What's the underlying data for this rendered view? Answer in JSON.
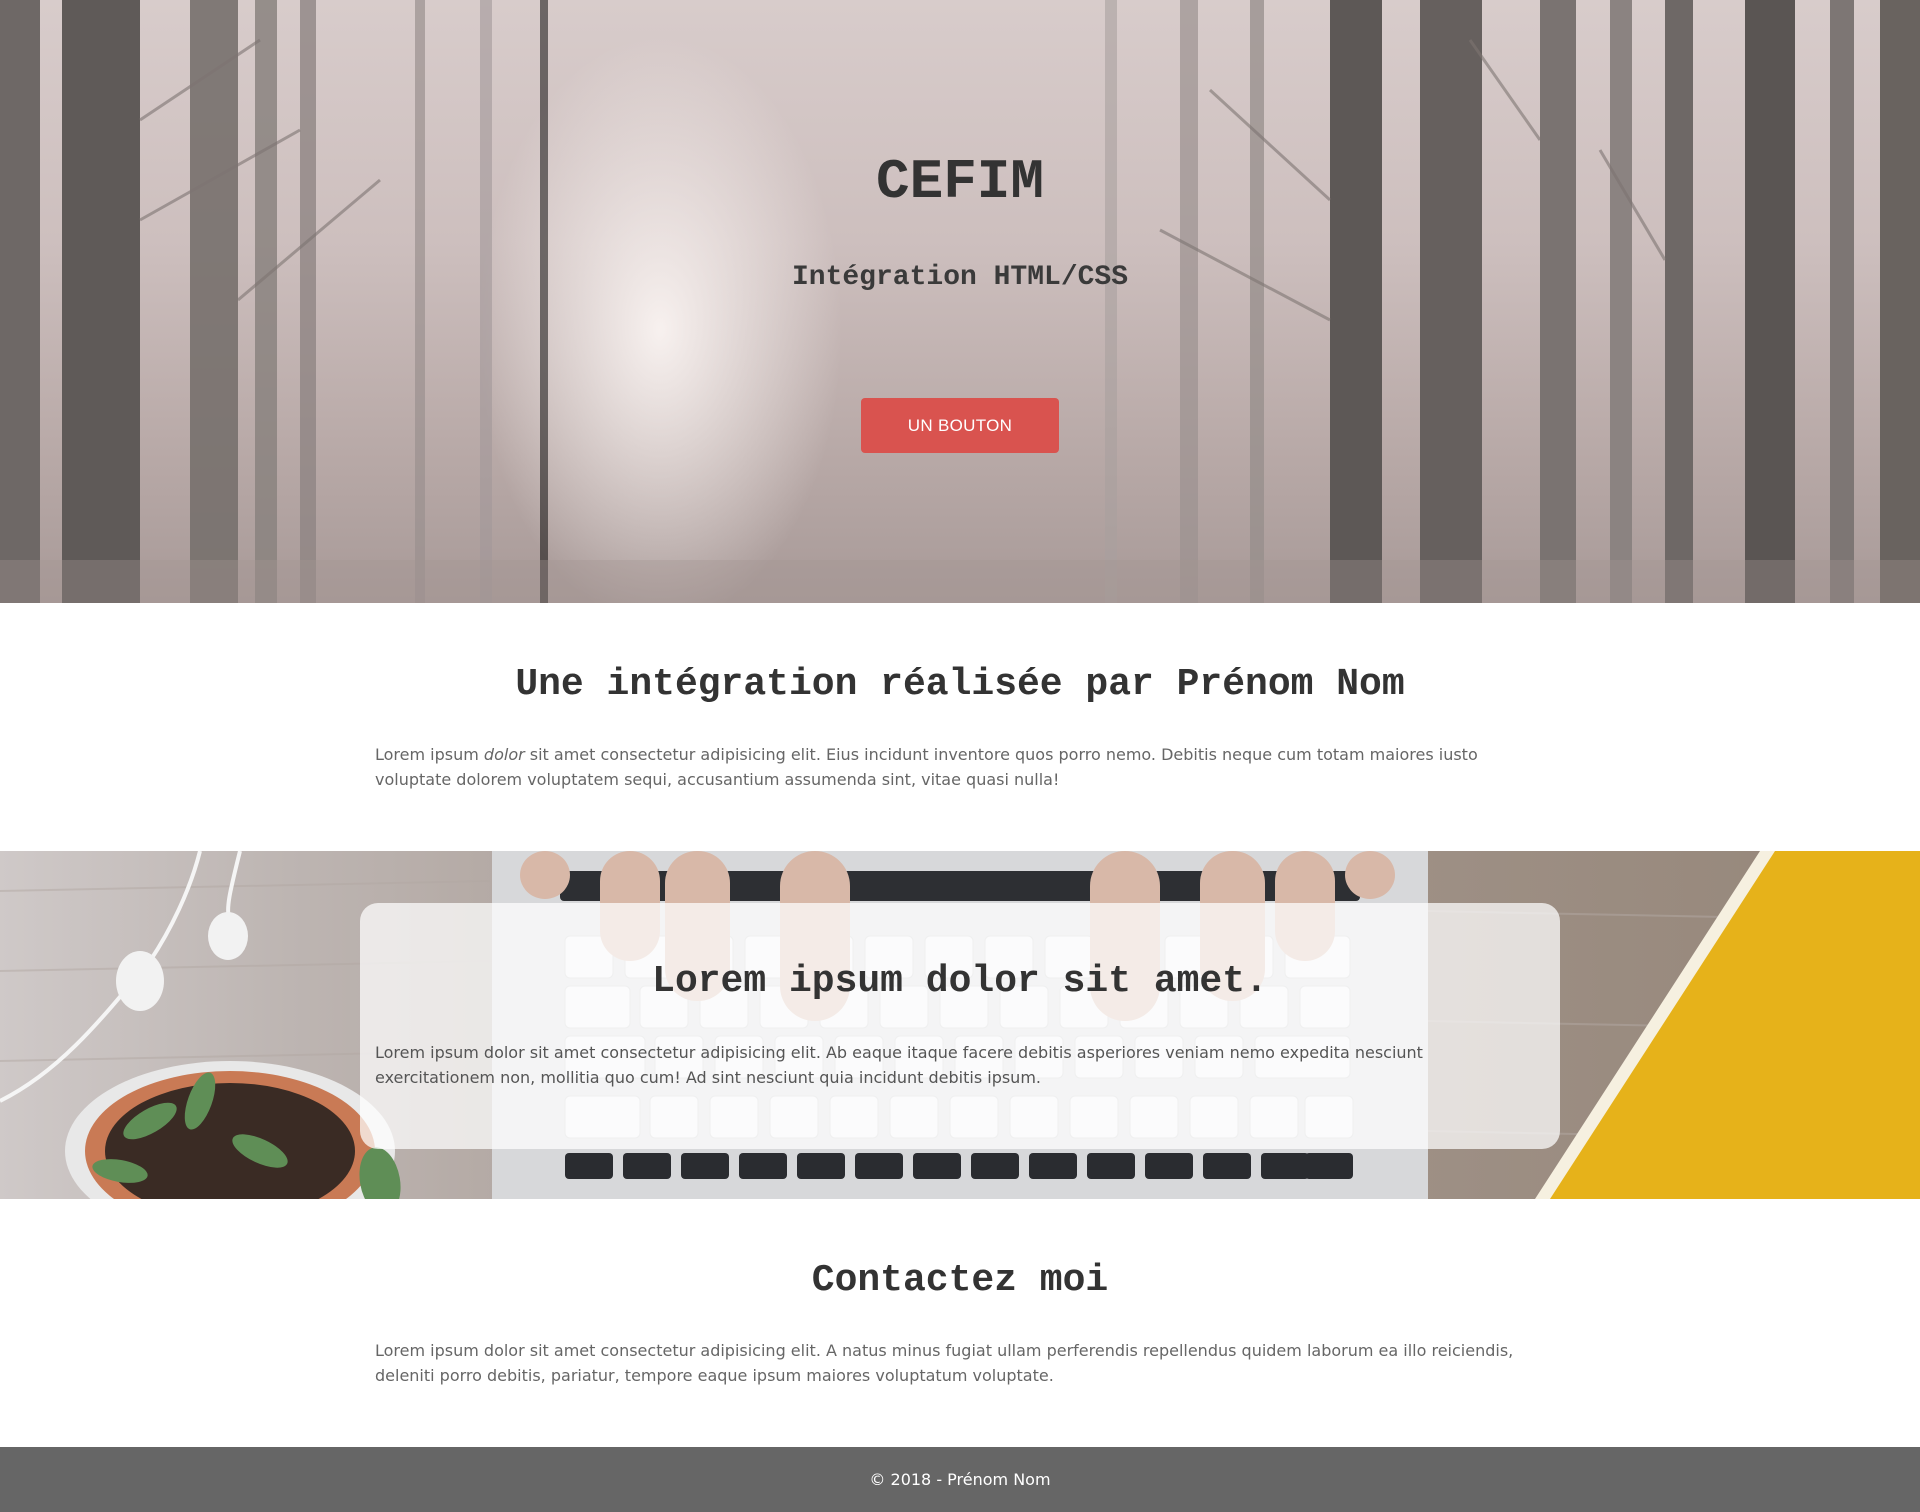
{
  "hero": {
    "title": "CEFIM",
    "subtitle": "Intégration HTML/CSS",
    "button_label": "UN BOUTON",
    "button_color": "#d9534f"
  },
  "intro": {
    "title": "Une intégration réalisée par Prénom Nom",
    "text_before": "Lorem ipsum ",
    "text_em": "dolor",
    "text_after": " sit amet consectetur adipisicing elit. Eius incidunt inventore quos porro nemo. Debitis neque cum totam maiores iusto voluptate dolorem voluptatem sequi, accusantium assumenda sint, vitae quasi nulla!"
  },
  "feature": {
    "title": "Lorem ipsum dolor sit amet.",
    "text": "Lorem ipsum dolor sit amet consectetur adipisicing elit. Ab eaque itaque facere debitis asperiores veniam nemo expedita nesciunt exercitationem non, mollitia quo cum! Ad sint nesciunt quia incidunt debitis ipsum."
  },
  "contact": {
    "title": "Contactez moi",
    "text": "Lorem ipsum dolor sit amet consectetur adipisicing elit. A natus minus fugiat ullam perferendis repellendus quidem laborum ea illo reiciendis, deleniti porro debitis, pariatur, tempore eaque ipsum maiores voluptatum voluptate."
  },
  "footer": {
    "text": "© 2018 - Prénom Nom",
    "background": "#666666"
  }
}
